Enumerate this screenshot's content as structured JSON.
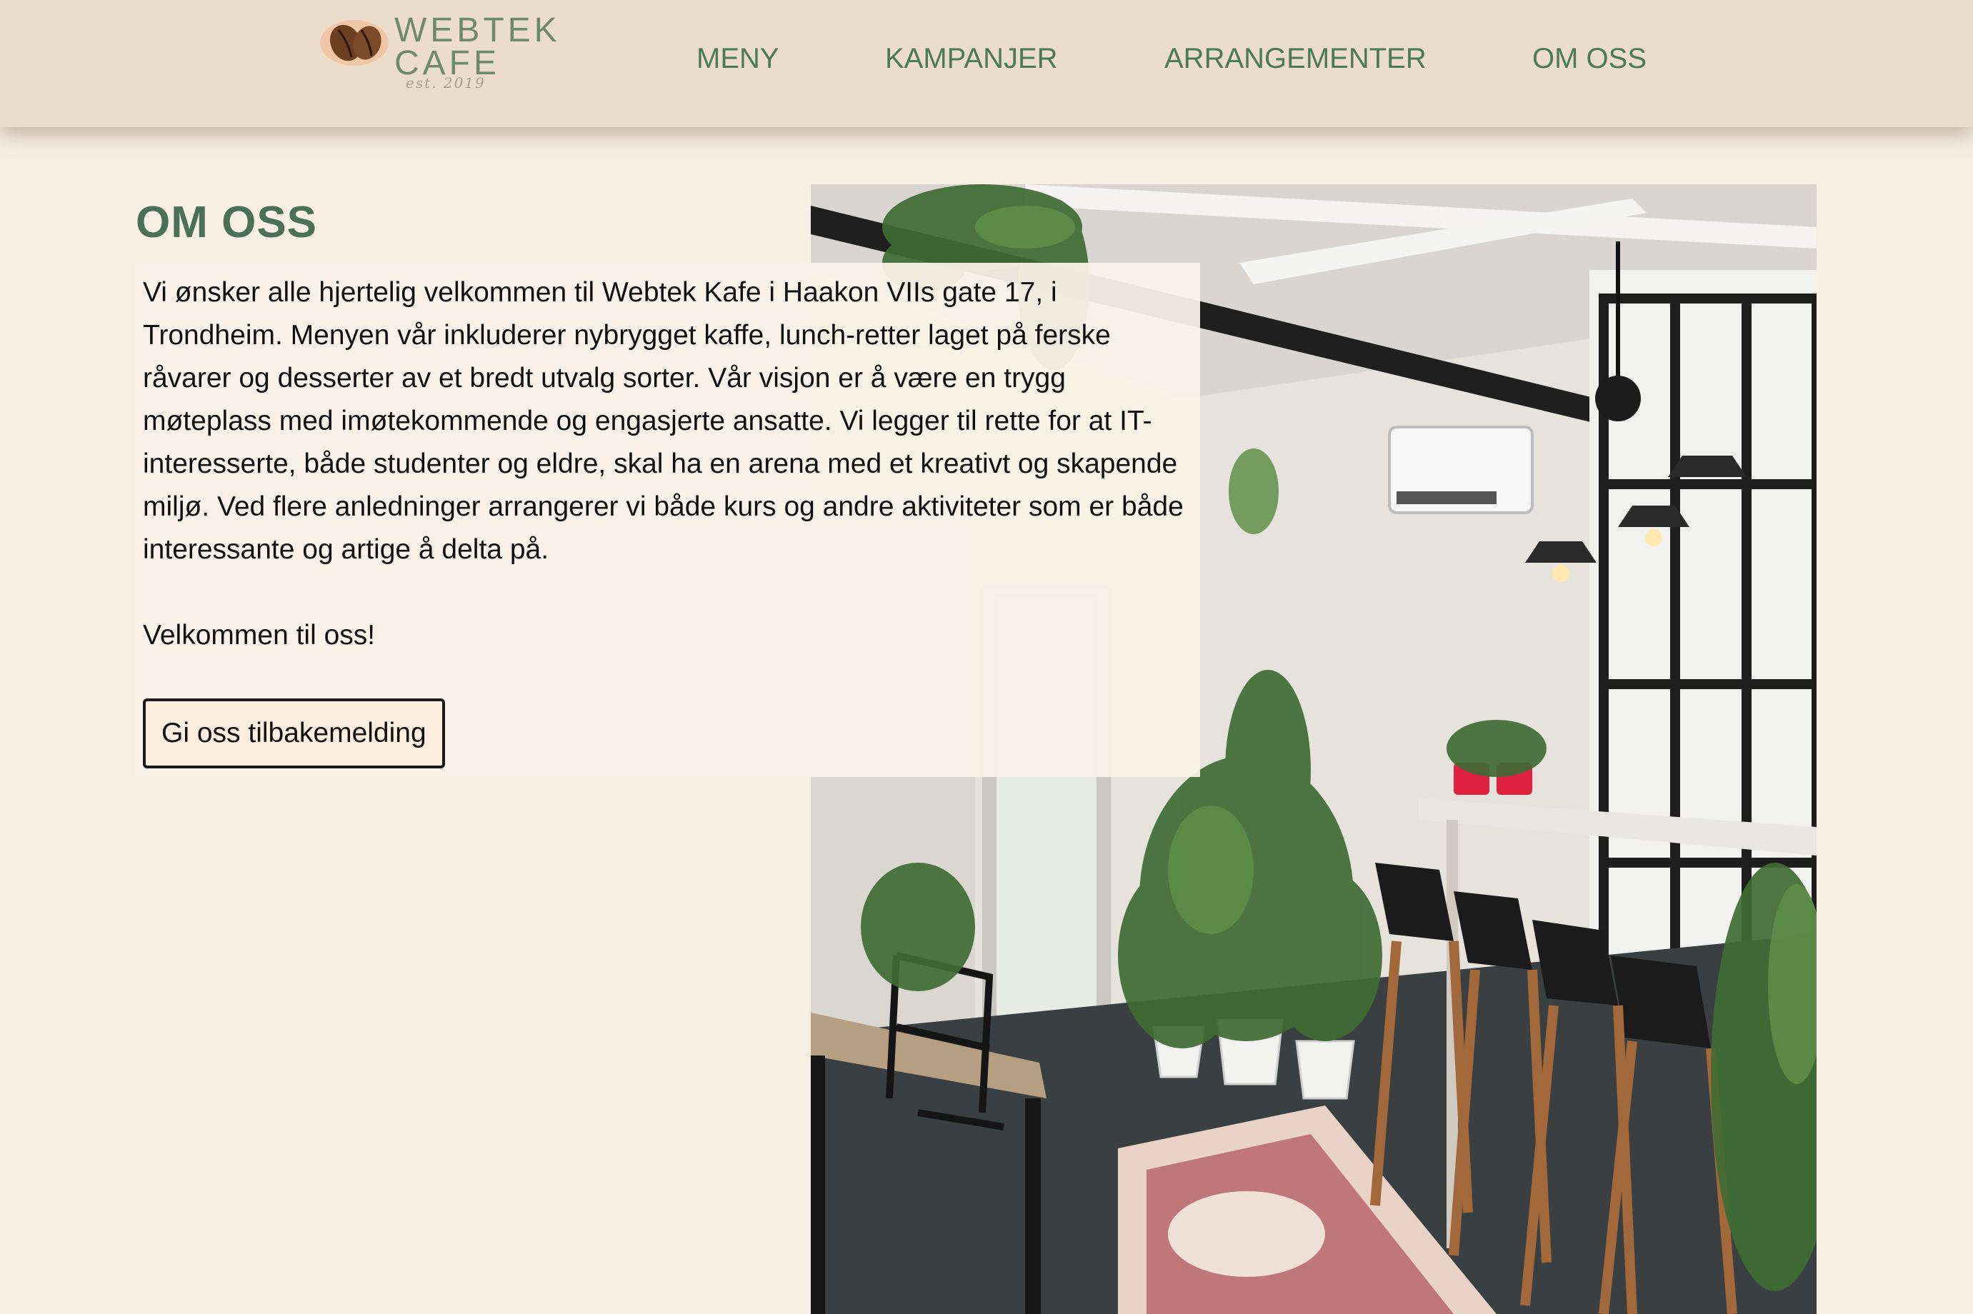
{
  "brand": {
    "logo_line1": "WEBTEK",
    "logo_line2": "CAFE",
    "logo_tagline": "est. 2019",
    "icon": "coffee-beans-icon"
  },
  "nav": {
    "items": [
      {
        "label": "MENY"
      },
      {
        "label": "KAMPANJER"
      },
      {
        "label": "ARRANGEMENTER"
      },
      {
        "label": "OM OSS"
      }
    ]
  },
  "page": {
    "title": "OM OSS",
    "intro": "Vi ønsker alle hjertelig velkommen til Webtek Kafe i Haakon VIIs gate 17, i Trondheim. Menyen vår inkluderer nybrygget kaffe, lunch-retter laget på ferske råvarer og desserter av et bredt utvalg sorter. Vår visjon er å være en trygg møteplass med imøtekommende og engasjerte ansatte. Vi legger til rette for at IT-interesserte, både studenter og eldre, skal ha en arena med et kreativt og skapende miljø. Ved flere anledninger arrangerer vi både kurs og andre aktiviteter som er både interessante og artige å delta på.",
    "welcome": "Velkommen til oss!",
    "feedback_button": "Gi oss tilbakemelding"
  },
  "colors": {
    "header_bg": "#ecdccb",
    "page_bg": "#f7efe3",
    "nav_text": "#4a7a56",
    "title_text": "#4a7158"
  }
}
